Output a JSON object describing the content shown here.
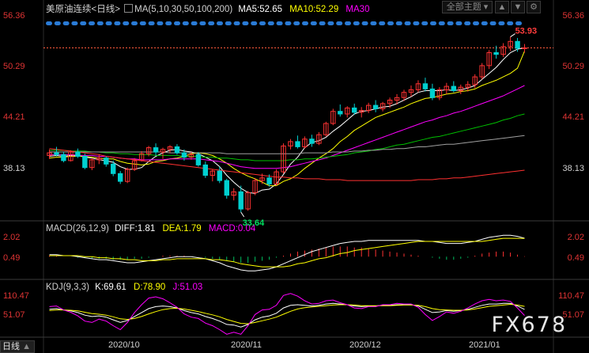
{
  "header": {
    "instrument": "美原油连续",
    "period": "<日线>",
    "ma_label": "MA(5,10,30,50,100,200)",
    "ma5": "MA5:52.65",
    "ma10": "MA10:52.29",
    "ma30": "MA30",
    "theme_button": "全部主题",
    "colors": {
      "ma5": "#ffffff",
      "ma10": "#ffff00",
      "ma30": "#ff00ff",
      "up": "#ff3232",
      "down": "#00d0d0"
    }
  },
  "price_axis": {
    "top": "56.36",
    "t2": "50.29",
    "t3": "44.21",
    "t4": "38.13"
  },
  "annotations": {
    "high": "53.93",
    "low": "33.64"
  },
  "macd": {
    "label": "MACD(26,12,9)",
    "diff": "DIFF:1.81",
    "dea": "DEA:1.79",
    "macd": "MACD:0.04",
    "axis_top": "2.02",
    "axis_low": "0.49"
  },
  "kdj": {
    "label": "KDJ(9,3,3)",
    "k": "K:69.61",
    "d": "D:78.90",
    "j": "J:51.03",
    "axis_top": "110.47",
    "axis_low": "51.07"
  },
  "time_axis": {
    "t1": "2020/10",
    "t2": "2020/11",
    "t3": "2020/12",
    "t4": "2021/01"
  },
  "corner_tab": "日线",
  "watermark": "FX678",
  "chart_data": {
    "type": "candlestick",
    "title": "美原油连续 <日线>",
    "ylim": [
      33.0,
      56.36
    ],
    "ma_params": [
      5,
      10,
      30,
      50,
      100,
      200
    ],
    "ma_latest": {
      "MA5": 52.65,
      "MA10": 52.29
    },
    "high_label": 53.93,
    "low_label": 33.64,
    "macd_latest": {
      "DIFF": 1.81,
      "DEA": 1.79,
      "MACD": 0.04
    },
    "kdj_latest": {
      "K": 69.61,
      "D": 78.9,
      "J": 51.03
    },
    "dates": [
      "2020/10",
      "2020/11",
      "2020/12",
      "2021/01"
    ],
    "candles": [
      [
        40.2,
        40.9,
        39.8,
        40.5
      ],
      [
        40.5,
        41.2,
        40.1,
        40.3
      ],
      [
        40.3,
        40.6,
        39.4,
        39.6
      ],
      [
        39.6,
        40.8,
        39.5,
        40.6
      ],
      [
        40.6,
        41.0,
        39.9,
        40.1
      ],
      [
        40.1,
        40.4,
        38.6,
        38.8
      ],
      [
        38.8,
        39.9,
        38.5,
        39.7
      ],
      [
        39.7,
        40.3,
        39.2,
        39.9
      ],
      [
        39.9,
        40.1,
        38.9,
        39.2
      ],
      [
        39.2,
        39.6,
        37.8,
        38.1
      ],
      [
        38.1,
        38.4,
        36.9,
        37.2
      ],
      [
        37.2,
        38.8,
        37.0,
        38.6
      ],
      [
        38.6,
        39.9,
        38.4,
        39.6
      ],
      [
        39.6,
        40.7,
        39.5,
        40.4
      ],
      [
        40.4,
        41.3,
        40.1,
        41.1
      ],
      [
        41.1,
        41.6,
        40.2,
        40.6
      ],
      [
        40.6,
        41.1,
        39.8,
        40.9
      ],
      [
        40.9,
        41.4,
        40.5,
        41.2
      ],
      [
        41.2,
        41.5,
        40.3,
        40.5
      ],
      [
        40.5,
        40.9,
        39.6,
        40.0
      ],
      [
        40.0,
        40.6,
        39.7,
        40.3
      ],
      [
        40.3,
        40.6,
        38.9,
        39.1
      ],
      [
        39.1,
        39.5,
        37.6,
        37.9
      ],
      [
        37.9,
        38.6,
        37.2,
        38.4
      ],
      [
        38.4,
        38.9,
        37.0,
        37.3
      ],
      [
        37.3,
        37.5,
        35.2,
        35.6
      ],
      [
        35.6,
        36.4,
        35.0,
        36.0
      ],
      [
        36.0,
        36.7,
        33.64,
        34.0
      ],
      [
        34.0,
        36.1,
        33.8,
        35.9
      ],
      [
        35.9,
        37.6,
        35.6,
        37.3
      ],
      [
        37.3,
        38.1,
        36.9,
        37.6
      ],
      [
        37.6,
        38.0,
        36.6,
        36.9
      ],
      [
        36.9,
        38.6,
        36.7,
        38.3
      ],
      [
        38.3,
        41.6,
        38.1,
        41.3
      ],
      [
        41.3,
        42.1,
        40.9,
        41.8
      ],
      [
        41.8,
        42.5,
        41.0,
        41.2
      ],
      [
        41.2,
        42.4,
        41.0,
        42.1
      ],
      [
        42.1,
        42.6,
        41.2,
        41.6
      ],
      [
        41.6,
        42.9,
        41.4,
        42.6
      ],
      [
        42.6,
        44.1,
        42.4,
        43.9
      ],
      [
        43.9,
        45.6,
        43.7,
        45.3
      ],
      [
        45.3,
        46.1,
        44.7,
        45.0
      ],
      [
        45.0,
        45.9,
        44.6,
        45.7
      ],
      [
        45.7,
        46.2,
        44.9,
        45.2
      ],
      [
        45.2,
        45.8,
        44.6,
        45.4
      ],
      [
        45.4,
        46.3,
        45.1,
        46.0
      ],
      [
        46.0,
        46.6,
        45.2,
        45.6
      ],
      [
        45.6,
        46.4,
        45.3,
        46.2
      ],
      [
        46.2,
        46.9,
        45.7,
        46.6
      ],
      [
        46.6,
        47.3,
        46.1,
        46.9
      ],
      [
        46.9,
        47.8,
        46.5,
        47.5
      ],
      [
        47.5,
        48.3,
        47.0,
        47.8
      ],
      [
        47.8,
        48.9,
        47.5,
        48.5
      ],
      [
        48.5,
        49.2,
        47.6,
        47.9
      ],
      [
        47.9,
        48.5,
        46.6,
        46.9
      ],
      [
        46.9,
        48.1,
        46.6,
        47.8
      ],
      [
        47.8,
        48.6,
        47.3,
        48.2
      ],
      [
        48.2,
        48.8,
        47.5,
        47.7
      ],
      [
        47.7,
        48.4,
        47.3,
        48.1
      ],
      [
        48.1,
        48.8,
        47.6,
        48.4
      ],
      [
        48.4,
        49.6,
        48.0,
        49.3
      ],
      [
        49.3,
        50.9,
        49.0,
        50.6
      ],
      [
        50.6,
        52.4,
        50.2,
        52.1
      ],
      [
        52.1,
        52.9,
        51.4,
        51.9
      ],
      [
        51.9,
        53.2,
        51.6,
        52.8
      ],
      [
        52.8,
        53.93,
        52.3,
        53.4
      ],
      [
        53.4,
        53.8,
        52.2,
        52.6
      ],
      [
        52.6,
        53.1,
        52.1,
        52.65
      ]
    ],
    "ma_lines": {
      "MA5": [
        40.1,
        40.2,
        40.1,
        40.2,
        40.2,
        40.0,
        39.9,
        39.7,
        39.6,
        39.4,
        38.9,
        38.6,
        38.6,
        38.8,
        39.5,
        40.1,
        40.5,
        40.8,
        40.9,
        40.7,
        40.6,
        40.4,
        40.0,
        39.6,
        38.9,
        37.9,
        37.1,
        36.4,
        35.9,
        35.8,
        36.2,
        36.3,
        36.9,
        38.0,
        39.2,
        40.0,
        41.1,
        41.7,
        41.9,
        42.3,
        43.0,
        43.6,
        44.3,
        45.0,
        45.3,
        45.4,
        45.6,
        45.8,
        45.9,
        46.2,
        46.6,
        47.0,
        47.5,
        47.7,
        47.7,
        47.7,
        47.8,
        47.7,
        47.8,
        48.0,
        48.3,
        49.0,
        49.7,
        50.4,
        51.3,
        52.1,
        52.5,
        52.65
      ],
      "MA10": [
        39.9,
        40.0,
        40.0,
        40.1,
        40.1,
        40.1,
        40.0,
        39.9,
        39.8,
        39.8,
        39.5,
        39.3,
        39.2,
        39.1,
        39.2,
        39.5,
        39.6,
        39.8,
        39.9,
        40.1,
        40.4,
        40.5,
        40.4,
        40.2,
        39.8,
        39.3,
        38.7,
        38.2,
        37.8,
        37.5,
        37.1,
        36.7,
        36.7,
        37.2,
        37.5,
        38.0,
        38.7,
        39.3,
        39.9,
        40.4,
        41.0,
        41.8,
        42.4,
        43.1,
        43.6,
        44.1,
        44.6,
        44.9,
        45.2,
        45.5,
        45.8,
        46.2,
        46.5,
        46.8,
        46.9,
        47.1,
        47.3,
        47.4,
        47.6,
        47.7,
        47.9,
        48.3,
        48.6,
        48.9,
        49.3,
        49.7,
        50.3,
        52.29
      ],
      "MA30": [
        40.3,
        40.3,
        40.3,
        40.3,
        40.2,
        40.2,
        40.2,
        40.1,
        40.1,
        40.0,
        39.9,
        39.8,
        39.8,
        39.7,
        39.7,
        39.7,
        39.7,
        39.8,
        39.8,
        39.8,
        39.8,
        39.8,
        39.7,
        39.6,
        39.5,
        39.3,
        39.1,
        38.9,
        38.8,
        38.7,
        38.7,
        38.7,
        38.7,
        38.8,
        38.9,
        39.1,
        39.3,
        39.5,
        39.7,
        39.9,
        40.2,
        40.5,
        40.8,
        41.1,
        41.4,
        41.7,
        42.0,
        42.3,
        42.6,
        42.9,
        43.2,
        43.5,
        43.8,
        44.1,
        44.3,
        44.6,
        44.8,
        45.1,
        45.3,
        45.6,
        45.9,
        46.2,
        46.5,
        46.8,
        47.1,
        47.5,
        47.9,
        48.3
      ],
      "MA50": [
        40.8,
        40.8,
        40.8,
        40.7,
        40.7,
        40.7,
        40.6,
        40.6,
        40.5,
        40.5,
        40.4,
        40.4,
        40.3,
        40.3,
        40.3,
        40.2,
        40.2,
        40.2,
        40.2,
        40.1,
        40.1,
        40.1,
        40.0,
        40.0,
        39.9,
        39.9,
        39.8,
        39.7,
        39.7,
        39.6,
        39.6,
        39.6,
        39.6,
        39.6,
        39.7,
        39.7,
        39.8,
        39.8,
        39.9,
        40.0,
        40.1,
        40.2,
        40.3,
        40.5,
        40.6,
        40.7,
        40.9,
        41.0,
        41.2,
        41.4,
        41.5,
        41.7,
        41.9,
        42.1,
        42.3,
        42.4,
        42.6,
        42.8,
        43.0,
        43.2,
        43.4,
        43.6,
        43.8,
        44.0,
        44.3,
        44.5,
        44.8,
        45.0
      ],
      "MA100": [
        40.6,
        40.6,
        40.6,
        40.6,
        40.6,
        40.6,
        40.6,
        40.6,
        40.6,
        40.6,
        40.6,
        40.6,
        40.6,
        40.6,
        40.6,
        40.6,
        40.6,
        40.5,
        40.5,
        40.5,
        40.5,
        40.5,
        40.5,
        40.5,
        40.5,
        40.4,
        40.4,
        40.4,
        40.4,
        40.4,
        40.4,
        40.4,
        40.4,
        40.4,
        40.4,
        40.4,
        40.5,
        40.5,
        40.5,
        40.5,
        40.6,
        40.6,
        40.6,
        40.7,
        40.7,
        40.8,
        40.8,
        40.9,
        40.9,
        41.0,
        41.0,
        41.1,
        41.2,
        41.2,
        41.3,
        41.4,
        41.5,
        41.5,
        41.6,
        41.7,
        41.8,
        41.9,
        42.0,
        42.1,
        42.2,
        42.3,
        42.4,
        42.5
      ],
      "MA200": [
        41.0,
        40.9,
        40.8,
        40.7,
        40.6,
        40.5,
        40.4,
        40.3,
        40.1,
        40.0,
        39.9,
        39.8,
        39.7,
        39.6,
        39.5,
        39.4,
        39.3,
        39.2,
        39.1,
        39.0,
        38.9,
        38.8,
        38.7,
        38.6,
        38.5,
        38.4,
        38.3,
        38.2,
        38.1,
        38.0,
        37.9,
        37.8,
        37.7,
        37.7,
        37.6,
        37.6,
        37.5,
        37.5,
        37.5,
        37.4,
        37.4,
        37.4,
        37.3,
        37.3,
        37.3,
        37.3,
        37.3,
        37.3,
        37.3,
        37.3,
        37.3,
        37.3,
        37.4,
        37.4,
        37.4,
        37.5,
        37.5,
        37.6,
        37.6,
        37.7,
        37.8,
        37.9,
        38.0,
        38.1,
        38.2,
        38.3,
        38.4,
        38.5
      ]
    },
    "macd_hist": [
      0.1,
      0.1,
      0.0,
      0.0,
      -0.1,
      -0.1,
      -0.2,
      -0.2,
      -0.2,
      -0.3,
      -0.3,
      -0.3,
      -0.2,
      -0.2,
      -0.1,
      0.0,
      0.1,
      0.1,
      0.1,
      0.1,
      0.0,
      0.0,
      -0.1,
      -0.2,
      -0.3,
      -0.4,
      -0.5,
      -0.6,
      -0.6,
      -0.5,
      -0.4,
      -0.3,
      -0.1,
      0.1,
      0.3,
      0.5,
      0.6,
      0.7,
      0.8,
      0.9,
      1.0,
      1.0,
      1.0,
      0.9,
      0.9,
      0.8,
      0.7,
      0.6,
      0.5,
      0.4,
      0.3,
      0.2,
      0.1,
      0.0,
      -0.1,
      -0.2,
      -0.3,
      -0.3,
      -0.2,
      -0.1,
      0.1,
      0.3,
      0.4,
      0.5,
      0.5,
      0.4,
      0.2,
      0.04
    ],
    "macd_diff": [
      0.2,
      0.2,
      0.1,
      0.1,
      0.0,
      -0.1,
      -0.2,
      -0.3,
      -0.3,
      -0.4,
      -0.5,
      -0.6,
      -0.6,
      -0.5,
      -0.4,
      -0.3,
      -0.2,
      -0.1,
      0.0,
      0.0,
      0.0,
      -0.1,
      -0.2,
      -0.4,
      -0.6,
      -0.9,
      -1.1,
      -1.3,
      -1.4,
      -1.4,
      -1.3,
      -1.2,
      -1.0,
      -0.7,
      -0.4,
      -0.1,
      0.2,
      0.5,
      0.7,
      0.9,
      1.1,
      1.3,
      1.4,
      1.5,
      1.5,
      1.6,
      1.6,
      1.6,
      1.6,
      1.6,
      1.6,
      1.6,
      1.6,
      1.5,
      1.5,
      1.4,
      1.3,
      1.3,
      1.3,
      1.4,
      1.5,
      1.7,
      1.9,
      2.0,
      2.1,
      2.1,
      2.0,
      1.81
    ],
    "macd_dea": [
      0.1,
      0.1,
      0.1,
      0.1,
      0.1,
      0.0,
      0.0,
      -0.1,
      -0.1,
      -0.2,
      -0.2,
      -0.3,
      -0.3,
      -0.4,
      -0.4,
      -0.4,
      -0.3,
      -0.3,
      -0.2,
      -0.2,
      -0.2,
      -0.2,
      -0.2,
      -0.3,
      -0.3,
      -0.4,
      -0.5,
      -0.7,
      -0.8,
      -0.9,
      -1.0,
      -1.0,
      -1.0,
      -1.0,
      -0.9,
      -0.7,
      -0.6,
      -0.4,
      -0.2,
      -0.1,
      0.1,
      0.3,
      0.4,
      0.6,
      0.7,
      0.8,
      0.9,
      1.0,
      1.1,
      1.2,
      1.3,
      1.4,
      1.5,
      1.5,
      1.5,
      1.5,
      1.5,
      1.5,
      1.5,
      1.5,
      1.5,
      1.5,
      1.6,
      1.7,
      1.8,
      1.8,
      1.8,
      1.79
    ],
    "kdj_k": [
      70,
      72,
      68,
      65,
      60,
      52,
      48,
      50,
      46,
      38,
      30,
      36,
      48,
      60,
      72,
      78,
      80,
      78,
      74,
      66,
      60,
      56,
      48,
      42,
      34,
      24,
      22,
      16,
      24,
      38,
      46,
      50,
      58,
      74,
      82,
      84,
      82,
      80,
      82,
      86,
      88,
      86,
      84,
      80,
      78,
      80,
      80,
      82,
      82,
      84,
      84,
      84,
      80,
      70,
      60,
      62,
      66,
      64,
      66,
      70,
      76,
      82,
      86,
      86,
      88,
      88,
      80,
      69.61
    ],
    "kdj_d": [
      66,
      68,
      68,
      67,
      65,
      61,
      57,
      55,
      52,
      47,
      41,
      39,
      42,
      48,
      56,
      63,
      69,
      72,
      73,
      71,
      67,
      63,
      58,
      53,
      47,
      39,
      33,
      27,
      26,
      30,
      35,
      40,
      46,
      55,
      64,
      71,
      75,
      77,
      79,
      81,
      83,
      84,
      84,
      83,
      81,
      81,
      81,
      81,
      81,
      82,
      83,
      83,
      82,
      78,
      72,
      69,
      68,
      67,
      67,
      68,
      71,
      75,
      79,
      81,
      83,
      85,
      83,
      78.9
    ],
    "kdj_j": [
      78,
      80,
      68,
      61,
      50,
      34,
      30,
      40,
      34,
      20,
      8,
      30,
      60,
      84,
      104,
      108,
      102,
      90,
      76,
      56,
      46,
      42,
      28,
      20,
      8,
      -6,
      0,
      -6,
      20,
      54,
      68,
      70,
      82,
      112,
      118,
      110,
      96,
      86,
      88,
      96,
      98,
      90,
      84,
      74,
      72,
      78,
      78,
      84,
      84,
      88,
      86,
      86,
      76,
      54,
      36,
      48,
      62,
      58,
      64,
      74,
      86,
      96,
      100,
      96,
      98,
      94,
      74,
      51.03
    ]
  }
}
